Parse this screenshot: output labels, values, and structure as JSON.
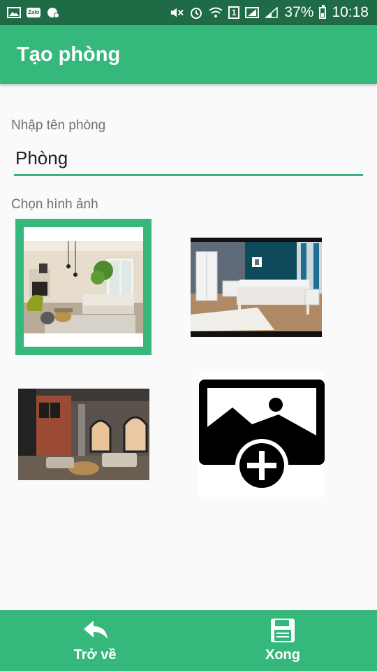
{
  "status_bar": {
    "battery_percent": "37%",
    "time": "10:18",
    "sim_slot": "1",
    "left_icons": [
      "gallery-icon",
      "zalo-icon",
      "settings-notification-icon"
    ],
    "zalo_label": "Zalo",
    "right_icons": [
      "mute-icon",
      "alarm-icon",
      "wifi-icon",
      "sim-icon",
      "signal-icon",
      "signal-icon",
      "battery-icon"
    ]
  },
  "app_bar": {
    "title": "Tạo phòng"
  },
  "form": {
    "name_label": "Nhập tên phòng",
    "name_value": "Phòng",
    "image_label": "Chọn hình ảnh"
  },
  "images": [
    {
      "id": "living-room",
      "selected": true
    },
    {
      "id": "bedroom",
      "selected": false
    },
    {
      "id": "loft",
      "selected": false
    },
    {
      "id": "add-image",
      "icon": "add-photo-icon"
    }
  ],
  "bottom_bar": {
    "back_label": "Trở về",
    "back_icon": "reply-icon",
    "done_label": "Xong",
    "done_icon": "save-icon"
  },
  "colors": {
    "accent": "#36b87c",
    "status_bar": "#1f6b46"
  }
}
